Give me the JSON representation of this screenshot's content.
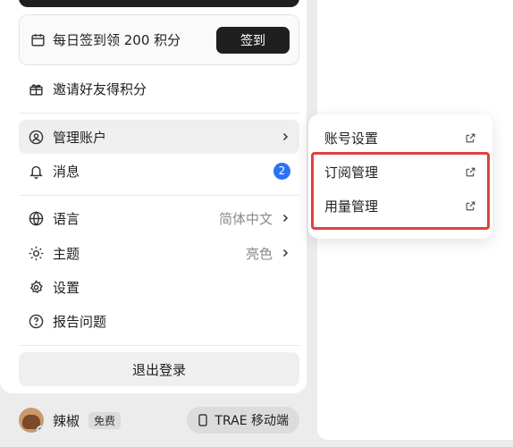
{
  "checkin": {
    "text": "每日签到领 200 积分",
    "button": "签到"
  },
  "invite": {
    "label": "邀请好友得积分"
  },
  "account": {
    "label": "管理账户"
  },
  "messages": {
    "label": "消息",
    "badge": "2"
  },
  "language": {
    "label": "语言",
    "value": "简体中文"
  },
  "theme": {
    "label": "主题",
    "value": "亮色"
  },
  "settings": {
    "label": "设置"
  },
  "report": {
    "label": "报告问题"
  },
  "logout": {
    "label": "退出登录"
  },
  "footer": {
    "username": "辣椒",
    "plan": "免费",
    "mobile_label": "TRAE 移动端"
  },
  "submenu": {
    "items": [
      {
        "label": "账号设置"
      },
      {
        "label": "订阅管理"
      },
      {
        "label": "用量管理"
      }
    ]
  },
  "colors": {
    "accent": "#2a74f5",
    "highlight": "#e0413e",
    "dark_button": "#1f1f1f"
  },
  "icons": [
    "calendar-icon",
    "gift-icon",
    "user-circle-icon",
    "bell-icon",
    "globe-icon",
    "sun-icon",
    "gear-icon",
    "help-circle-icon",
    "chevron-right-icon",
    "external-link-icon",
    "phone-icon"
  ]
}
